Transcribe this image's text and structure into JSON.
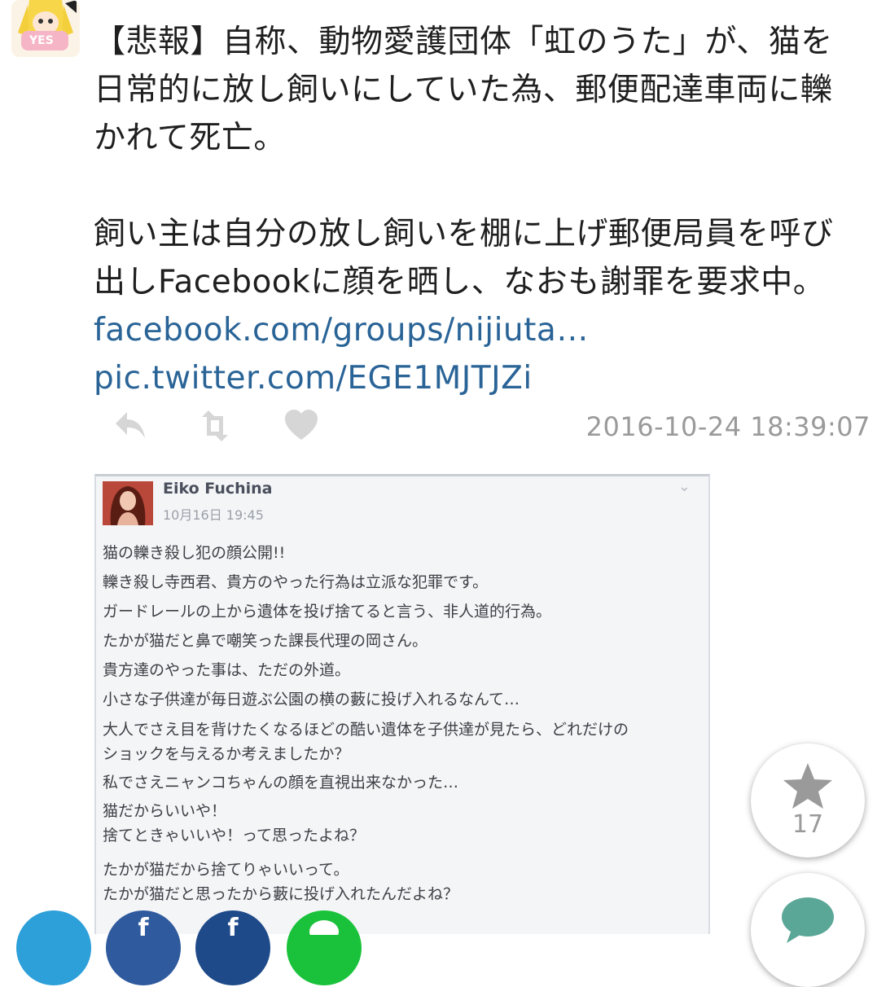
{
  "avatar": {
    "badge_text": "YES"
  },
  "tweet": {
    "line1": "【悲報】自称、動物愛護団体「虹のうた」が、猫を",
    "line2": "日常的に放し飼いにしていた為、郵便配達車両に轢",
    "line3": "かれて死亡。",
    "line4": "飼い主は自分の放し飼いを棚に上げ郵便局員を呼び",
    "line5": "出しFacebookに顔を晒し、なおも謝罪を要求中。",
    "link1": "facebook.com/groups/nijiuta…",
    "link2": "pic.twitter.com/EGE1MJTJZi"
  },
  "actions": {
    "reply_icon": "reply-icon",
    "retweet_icon": "retweet-icon",
    "like_icon": "heart-icon",
    "timestamp": "2016-10-24 18:39:07"
  },
  "embed": {
    "name": "Eiko Fuchina",
    "date": "10月16日 19:45",
    "lines": [
      "猫の轢き殺し犯の顔公開!!",
      "轢き殺し寺西君、貴方のやった行為は立派な犯罪です。",
      "ガードレールの上から遺体を投げ捨てると言う、非人道的行為。",
      "たかが猫だと鼻で嘲笑った課長代理の岡さん。",
      "貴方達のやった事は、ただの外道。",
      "小さな子供達が毎日遊ぶ公園の横の藪に投げ入れるなんて…",
      "大人でさえ目を背けたくなるほどの酷い遺体を子供達が見たら、どれだけの",
      "ショックを与えるか考えましたか？",
      "私でさえニャンコちゃんの顔を直視出来なかった…",
      "猫だからいいや！",
      "捨てときゃいいや！って思ったよね？",
      "たかが猫だから捨てりゃいいって。",
      "たかが猫だと思ったから藪に投げ入れたんだよね？"
    ]
  },
  "fab": {
    "star_icon": "star-icon",
    "star_count": "17",
    "comment_icon": "comment-icon"
  },
  "colors": {
    "link": "#2a6497",
    "icon_gray": "#d6d6d6",
    "timestamp": "#9a9a9a",
    "twitter_blue": "#2d9fd9",
    "facebook_blue": "#3b5998",
    "line_green": "#19c23a",
    "comment_teal": "#5aa797"
  }
}
